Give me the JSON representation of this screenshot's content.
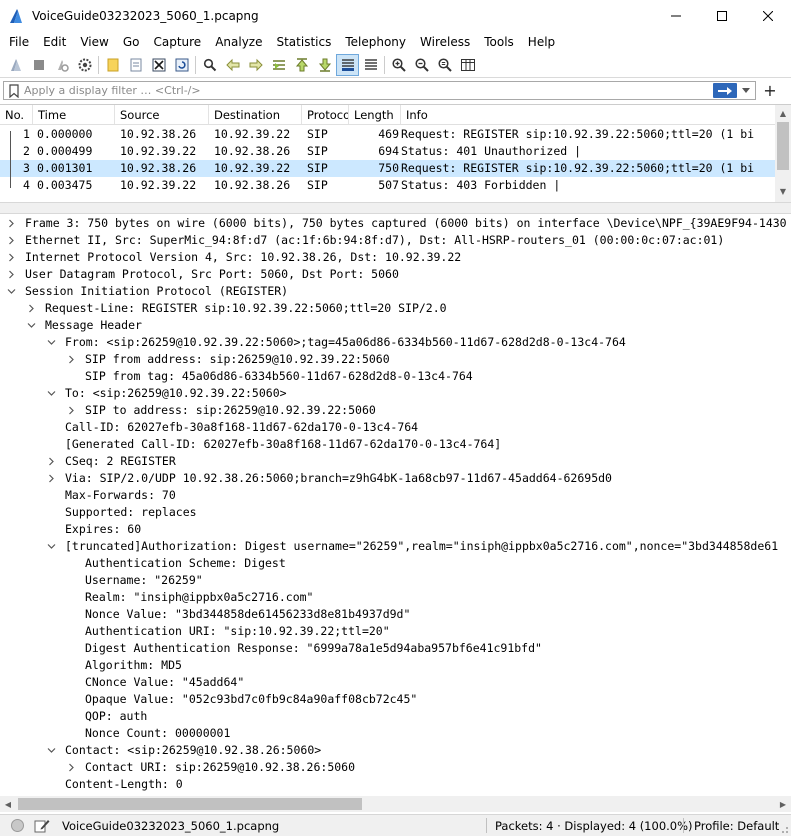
{
  "window": {
    "title": "VoiceGuide03232023_5060_1.pcapng",
    "minimize": "—",
    "maximize": "☐",
    "close": "✕"
  },
  "menu": [
    "File",
    "Edit",
    "View",
    "Go",
    "Capture",
    "Analyze",
    "Statistics",
    "Telephony",
    "Wireless",
    "Tools",
    "Help"
  ],
  "toolbar_icons": [
    "shark-start-icon",
    "stop-icon",
    "restart-icon",
    "options-gear-icon",
    "open-file-icon",
    "save-file-icon",
    "close-file-icon",
    "reload-icon",
    "find-icon",
    "go-back-icon",
    "go-forward-icon",
    "go-to-packet-icon",
    "go-first-icon",
    "go-last-icon",
    "autoscroll-icon",
    "colorize-icon",
    "zoom-in-icon",
    "zoom-out-icon",
    "zoom-normal-icon",
    "resize-columns-icon"
  ],
  "filter": {
    "placeholder": "Apply a display filter … <Ctrl-/>",
    "plus": "+"
  },
  "packet_list": {
    "columns": [
      "No.",
      "Time",
      "Source",
      "Destination",
      "Protocol",
      "Length",
      "Info"
    ],
    "rows": [
      {
        "no": "1",
        "time": "0.000000",
        "src": "10.92.38.26",
        "dst": "10.92.39.22",
        "proto": "SIP",
        "len": "469",
        "info": "Request: REGISTER sip:10.92.39.22:5060;ttl=20  (1 bi",
        "selected": false
      },
      {
        "no": "2",
        "time": "0.000499",
        "src": "10.92.39.22",
        "dst": "10.92.38.26",
        "proto": "SIP",
        "len": "694",
        "info": "Status: 401 Unauthorized |",
        "selected": false
      },
      {
        "no": "3",
        "time": "0.001301",
        "src": "10.92.38.26",
        "dst": "10.92.39.22",
        "proto": "SIP",
        "len": "750",
        "info": "Request: REGISTER sip:10.92.39.22:5060;ttl=20  (1 bi",
        "selected": true
      },
      {
        "no": "4",
        "time": "0.003475",
        "src": "10.92.39.22",
        "dst": "10.92.38.26",
        "proto": "SIP",
        "len": "507",
        "info": "Status: 403 Forbidden |",
        "selected": false
      }
    ]
  },
  "details": [
    {
      "indent": 0,
      "toggle": "closed",
      "text": "Frame 3: 750 bytes on wire (6000 bits), 750 bytes captured (6000 bits) on interface \\Device\\NPF_{39AE9F94-1430"
    },
    {
      "indent": 0,
      "toggle": "closed",
      "text": "Ethernet II, Src: SuperMic_94:8f:d7 (ac:1f:6b:94:8f:d7), Dst: All-HSRP-routers_01 (00:00:0c:07:ac:01)"
    },
    {
      "indent": 0,
      "toggle": "closed",
      "text": "Internet Protocol Version 4, Src: 10.92.38.26, Dst: 10.92.39.22"
    },
    {
      "indent": 0,
      "toggle": "closed",
      "text": "User Datagram Protocol, Src Port: 5060, Dst Port: 5060"
    },
    {
      "indent": 0,
      "toggle": "open",
      "text": "Session Initiation Protocol (REGISTER)"
    },
    {
      "indent": 1,
      "toggle": "closed",
      "text": "Request-Line: REGISTER sip:10.92.39.22:5060;ttl=20 SIP/2.0"
    },
    {
      "indent": 1,
      "toggle": "open",
      "text": "Message Header"
    },
    {
      "indent": 2,
      "toggle": "open",
      "text": "From: <sip:26259@10.92.39.22:5060>;tag=45a06d86-6334b560-11d67-628d2d8-0-13c4-764"
    },
    {
      "indent": 3,
      "toggle": "closed",
      "text": "SIP from address: sip:26259@10.92.39.22:5060"
    },
    {
      "indent": 3,
      "toggle": "none",
      "text": "SIP from tag: 45a06d86-6334b560-11d67-628d2d8-0-13c4-764"
    },
    {
      "indent": 2,
      "toggle": "open",
      "text": "To: <sip:26259@10.92.39.22:5060>"
    },
    {
      "indent": 3,
      "toggle": "closed",
      "text": "SIP to address: sip:26259@10.92.39.22:5060"
    },
    {
      "indent": 2,
      "toggle": "none",
      "text": "Call-ID: 62027efb-30a8f168-11d67-62da170-0-13c4-764"
    },
    {
      "indent": 2,
      "toggle": "none",
      "text": "[Generated Call-ID: 62027efb-30a8f168-11d67-62da170-0-13c4-764]"
    },
    {
      "indent": 2,
      "toggle": "closed",
      "text": "CSeq: 2 REGISTER"
    },
    {
      "indent": 2,
      "toggle": "closed",
      "text": "Via: SIP/2.0/UDP 10.92.38.26:5060;branch=z9hG4bK-1a68cb97-11d67-45add64-62695d0"
    },
    {
      "indent": 2,
      "toggle": "none",
      "text": "Max-Forwards: 70"
    },
    {
      "indent": 2,
      "toggle": "none",
      "text": "Supported: replaces"
    },
    {
      "indent": 2,
      "toggle": "none",
      "text": "Expires: 60"
    },
    {
      "indent": 2,
      "toggle": "open",
      "text": " [truncated]Authorization: Digest username=\"26259\",realm=\"insiph@ippbx0a5c2716.com\",nonce=\"3bd344858de61"
    },
    {
      "indent": 3,
      "toggle": "none",
      "text": "Authentication Scheme: Digest"
    },
    {
      "indent": 3,
      "toggle": "none",
      "text": "Username: \"26259\""
    },
    {
      "indent": 3,
      "toggle": "none",
      "text": "Realm: \"insiph@ippbx0a5c2716.com\""
    },
    {
      "indent": 3,
      "toggle": "none",
      "text": "Nonce Value: \"3bd344858de61456233d8e81b4937d9d\""
    },
    {
      "indent": 3,
      "toggle": "none",
      "text": "Authentication URI: \"sip:10.92.39.22;ttl=20\""
    },
    {
      "indent": 3,
      "toggle": "none",
      "text": "Digest Authentication Response: \"6999a78a1e5d94aba957bf6e41c91bfd\""
    },
    {
      "indent": 3,
      "toggle": "none",
      "text": "Algorithm: MD5"
    },
    {
      "indent": 3,
      "toggle": "none",
      "text": "CNonce Value: \"45add64\""
    },
    {
      "indent": 3,
      "toggle": "none",
      "text": "Opaque Value: \"052c93bd7c0fb9c84a90aff08cb72c45\""
    },
    {
      "indent": 3,
      "toggle": "none",
      "text": "QOP: auth"
    },
    {
      "indent": 3,
      "toggle": "none",
      "text": "Nonce Count: 00000001"
    },
    {
      "indent": 2,
      "toggle": "open",
      "text": "Contact: <sip:26259@10.92.38.26:5060>"
    },
    {
      "indent": 3,
      "toggle": "closed",
      "text": "Contact URI: sip:26259@10.92.38.26:5060"
    },
    {
      "indent": 2,
      "toggle": "none",
      "text": "Content-Length: 0"
    }
  ],
  "statusbar": {
    "file": "VoiceGuide03232023_5060_1.pcapng",
    "packets": "Packets: 4 · Displayed: 4 (100.0%)",
    "profile": "Profile: Default"
  },
  "colors": {
    "selected_row": "#cce8ff",
    "accent_blue": "#2d67b9"
  }
}
